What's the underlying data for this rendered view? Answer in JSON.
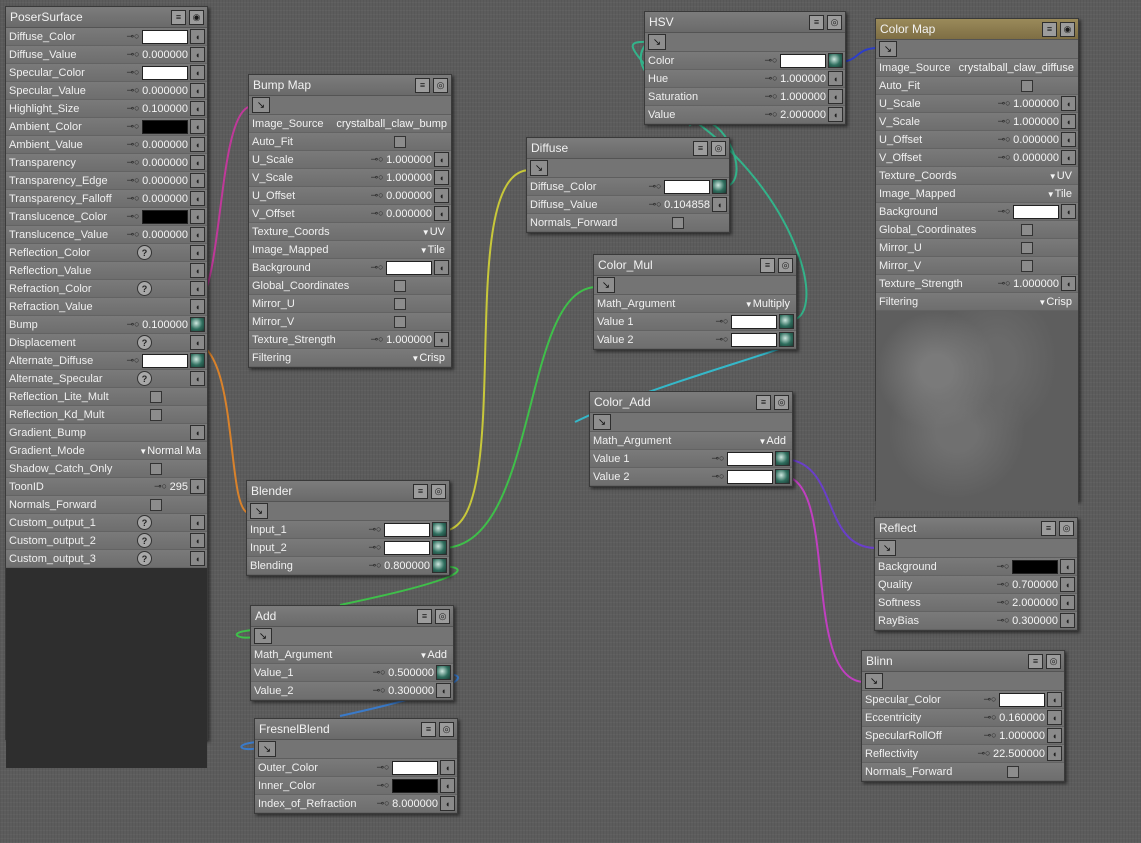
{
  "nodes": {
    "poser_surface": {
      "title": "PoserSurface",
      "rows": [
        {
          "label": "Diffuse_Color",
          "kind": "color",
          "color": "white"
        },
        {
          "label": "Diffuse_Value",
          "kind": "num",
          "value": "0.000000"
        },
        {
          "label": "Specular_Color",
          "kind": "color",
          "color": "white"
        },
        {
          "label": "Specular_Value",
          "kind": "num",
          "value": "0.000000"
        },
        {
          "label": "Highlight_Size",
          "kind": "num",
          "value": "0.100000"
        },
        {
          "label": "Ambient_Color",
          "kind": "color",
          "color": "black"
        },
        {
          "label": "Ambient_Value",
          "kind": "num",
          "value": "0.000000"
        },
        {
          "label": "Transparency",
          "kind": "num",
          "value": "0.000000"
        },
        {
          "label": "Transparency_Edge",
          "kind": "num",
          "value": "0.000000"
        },
        {
          "label": "Transparency_Falloff",
          "kind": "num",
          "value": "0.000000"
        },
        {
          "label": "Translucence_Color",
          "kind": "color",
          "color": "black"
        },
        {
          "label": "Translucence_Value",
          "kind": "num",
          "value": "0.000000"
        },
        {
          "label": "Reflection_Color",
          "kind": "help"
        },
        {
          "label": "Reflection_Value",
          "kind": "plug"
        },
        {
          "label": "Refraction_Color",
          "kind": "help"
        },
        {
          "label": "Refraction_Value",
          "kind": "plug"
        },
        {
          "label": "Bump",
          "kind": "num",
          "value": "0.100000",
          "conn": true
        },
        {
          "label": "Displacement",
          "kind": "help"
        },
        {
          "label": "Alternate_Diffuse",
          "kind": "color",
          "color": "white",
          "conn": true
        },
        {
          "label": "Alternate_Specular",
          "kind": "help"
        },
        {
          "label": "Reflection_Lite_Mult",
          "kind": "check"
        },
        {
          "label": "Reflection_Kd_Mult",
          "kind": "check"
        },
        {
          "label": "Gradient_Bump",
          "kind": "plug"
        },
        {
          "label": "Gradient_Mode",
          "kind": "dd",
          "value": "Normal Ma"
        },
        {
          "label": "Shadow_Catch_Only",
          "kind": "check"
        },
        {
          "label": "ToonID",
          "kind": "num",
          "value": "295"
        },
        {
          "label": "Normals_Forward",
          "kind": "check"
        },
        {
          "label": "Custom_output_1",
          "kind": "help"
        },
        {
          "label": "Custom_output_2",
          "kind": "help"
        },
        {
          "label": "Custom_output_3",
          "kind": "help"
        }
      ]
    },
    "bump_map": {
      "title": "Bump Map",
      "rows": [
        {
          "label": "Image_Source",
          "kind": "text",
          "value": "crystalball_claw_bump"
        },
        {
          "label": "Auto_Fit",
          "kind": "check"
        },
        {
          "label": "U_Scale",
          "kind": "num",
          "value": "1.000000"
        },
        {
          "label": "V_Scale",
          "kind": "num",
          "value": "1.000000"
        },
        {
          "label": "U_Offset",
          "kind": "num",
          "value": "0.000000"
        },
        {
          "label": "V_Offset",
          "kind": "num",
          "value": "0.000000"
        },
        {
          "label": "Texture_Coords",
          "kind": "dd",
          "value": "UV"
        },
        {
          "label": "Image_Mapped",
          "kind": "dd",
          "value": "Tile"
        },
        {
          "label": "Background",
          "kind": "color",
          "color": "white"
        },
        {
          "label": "Global_Coordinates",
          "kind": "check"
        },
        {
          "label": "Mirror_U",
          "kind": "check"
        },
        {
          "label": "Mirror_V",
          "kind": "check"
        },
        {
          "label": "Texture_Strength",
          "kind": "num",
          "value": "1.000000"
        },
        {
          "label": "Filtering",
          "kind": "dd",
          "value": "Crisp"
        }
      ]
    },
    "hsv": {
      "title": "HSV",
      "rows": [
        {
          "label": "Color",
          "kind": "color",
          "color": "white",
          "conn": true
        },
        {
          "label": "Hue",
          "kind": "num",
          "value": "1.000000"
        },
        {
          "label": "Saturation",
          "kind": "num",
          "value": "1.000000"
        },
        {
          "label": "Value",
          "kind": "num",
          "value": "2.000000"
        }
      ]
    },
    "color_map": {
      "title": "Color Map",
      "rows": [
        {
          "label": "Image_Source",
          "kind": "text",
          "value": "crystalball_claw_diffuse"
        },
        {
          "label": "Auto_Fit",
          "kind": "check"
        },
        {
          "label": "U_Scale",
          "kind": "num",
          "value": "1.000000"
        },
        {
          "label": "V_Scale",
          "kind": "num",
          "value": "1.000000"
        },
        {
          "label": "U_Offset",
          "kind": "num",
          "value": "0.000000"
        },
        {
          "label": "V_Offset",
          "kind": "num",
          "value": "0.000000"
        },
        {
          "label": "Texture_Coords",
          "kind": "dd",
          "value": "UV"
        },
        {
          "label": "Image_Mapped",
          "kind": "dd",
          "value": "Tile"
        },
        {
          "label": "Background",
          "kind": "color",
          "color": "white"
        },
        {
          "label": "Global_Coordinates",
          "kind": "check"
        },
        {
          "label": "Mirror_U",
          "kind": "check"
        },
        {
          "label": "Mirror_V",
          "kind": "check"
        },
        {
          "label": "Texture_Strength",
          "kind": "num",
          "value": "1.000000"
        },
        {
          "label": "Filtering",
          "kind": "dd",
          "value": "Crisp"
        }
      ]
    },
    "diffuse": {
      "title": "Diffuse",
      "rows": [
        {
          "label": "Diffuse_Color",
          "kind": "color",
          "color": "white",
          "conn": true
        },
        {
          "label": "Diffuse_Value",
          "kind": "num",
          "value": "0.104858"
        },
        {
          "label": "Normals_Forward",
          "kind": "check"
        }
      ]
    },
    "color_mul": {
      "title": "Color_Mul",
      "rows": [
        {
          "label": "Math_Argument",
          "kind": "dd",
          "value": "Multiply"
        },
        {
          "label": "Value 1",
          "kind": "color",
          "color": "white",
          "conn": true
        },
        {
          "label": "Value 2",
          "kind": "color",
          "color": "white",
          "conn": true
        }
      ]
    },
    "color_add": {
      "title": "Color_Add",
      "rows": [
        {
          "label": "Math_Argument",
          "kind": "dd",
          "value": "Add"
        },
        {
          "label": "Value 1",
          "kind": "color",
          "color": "white",
          "conn": true
        },
        {
          "label": "Value 2",
          "kind": "color",
          "color": "white",
          "conn": true
        }
      ]
    },
    "blender": {
      "title": "Blender",
      "rows": [
        {
          "label": "Input_1",
          "kind": "color",
          "color": "white",
          "conn": true
        },
        {
          "label": "Input_2",
          "kind": "color",
          "color": "white",
          "conn": true
        },
        {
          "label": "Blending",
          "kind": "num",
          "value": "0.800000",
          "conn": true
        }
      ]
    },
    "add": {
      "title": "Add",
      "rows": [
        {
          "label": "Math_Argument",
          "kind": "dd",
          "value": "Add"
        },
        {
          "label": "Value_1",
          "kind": "num",
          "value": "0.500000",
          "conn": true
        },
        {
          "label": "Value_2",
          "kind": "num",
          "value": "0.300000"
        }
      ]
    },
    "fresnel_blend": {
      "title": "FresnelBlend",
      "rows": [
        {
          "label": "Outer_Color",
          "kind": "color",
          "color": "white"
        },
        {
          "label": "Inner_Color",
          "kind": "color",
          "color": "black"
        },
        {
          "label": "Index_of_Refraction",
          "kind": "num",
          "value": "8.000000"
        }
      ]
    },
    "reflect": {
      "title": "Reflect",
      "rows": [
        {
          "label": "Background",
          "kind": "color",
          "color": "black"
        },
        {
          "label": "Quality",
          "kind": "num",
          "value": "0.700000"
        },
        {
          "label": "Softness",
          "kind": "num",
          "value": "2.000000"
        },
        {
          "label": "RayBias",
          "kind": "num",
          "value": "0.300000"
        }
      ]
    },
    "blinn": {
      "title": "Blinn",
      "rows": [
        {
          "label": "Specular_Color",
          "kind": "color",
          "color": "white"
        },
        {
          "label": "Eccentricity",
          "kind": "num",
          "value": "0.160000"
        },
        {
          "label": "SpecularRollOff",
          "kind": "num",
          "value": "1.000000"
        },
        {
          "label": "Reflectivity",
          "kind": "num",
          "value": "22.500000"
        },
        {
          "label": "Normals_Forward",
          "kind": "check"
        }
      ]
    }
  },
  "icons": {
    "menu": "menu-icon",
    "toggle": "preview-toggle-icon",
    "tool": "node-tool-icon",
    "help": "?",
    "key": "⚷",
    "arrow": "▼"
  },
  "wire_colors": {
    "magenta": "#c0399a",
    "orange": "#d9822b",
    "yellow": "#c8c83a",
    "green": "#3fbf4a",
    "teal": "#33b38a",
    "cyan": "#35b8c9",
    "blue": "#3a5ec9",
    "purple": "#6a3fc9",
    "pink": "#c03fc0"
  }
}
